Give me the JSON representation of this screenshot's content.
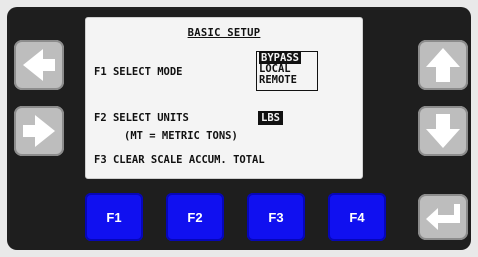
{
  "screen": {
    "title": "BASIC SETUP",
    "f1_label": "F1 SELECT MODE",
    "mode_options": [
      "BYPASS",
      "LOCAL",
      "REMOTE"
    ],
    "f2_label": "F2 SELECT UNITS",
    "units_value": "LBS",
    "units_note": "(MT = METRIC TONS)",
    "f3_label": "F3 CLEAR SCALE ACCUM. TOTAL"
  },
  "function_keys": [
    "F1",
    "F2",
    "F3",
    "F4"
  ],
  "icons": {
    "left": "arrow-left-icon",
    "right": "arrow-right-icon",
    "up": "arrow-up-icon",
    "down": "arrow-down-icon",
    "enter": "enter-icon"
  },
  "colors": {
    "fkey_blue": "#1010f0",
    "button_gray": "#bdbdbd",
    "bezel": "#1e1e1e",
    "screen_bg": "#f4f4f4"
  }
}
